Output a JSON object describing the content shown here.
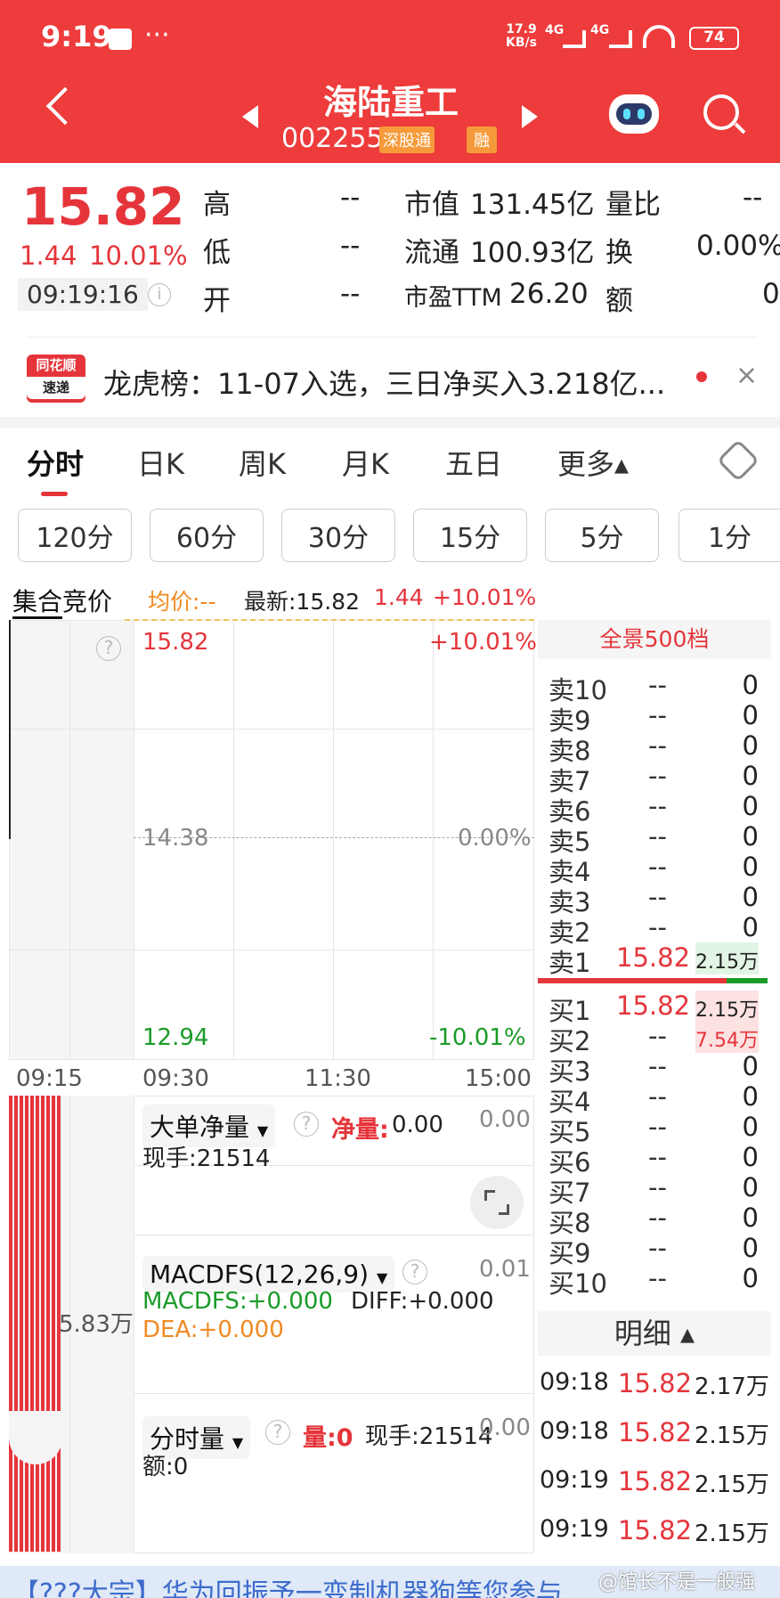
{
  "status_bar": {
    "time": "9:19",
    "dots": "···",
    "net_speed_top": "17.9",
    "net_speed_unit": "KB/s",
    "sig1": "4G",
    "sig2": "4G",
    "battery": "74"
  },
  "header": {
    "title": "海陆重工",
    "code": "002255",
    "badge_connect": "深股通",
    "badge_margin": "融"
  },
  "quote": {
    "price": "15.82",
    "change": "1.44",
    "change_pct": "10.01%",
    "time": "09:19:16",
    "fields": [
      {
        "label": "高",
        "value": "--"
      },
      {
        "label": "低",
        "value": "--"
      },
      {
        "label": "开",
        "value": "--"
      }
    ],
    "mid": [
      {
        "label": "市值",
        "value": "131.45亿"
      },
      {
        "label": "流通",
        "value": "100.93亿"
      },
      {
        "label": "市盈TTM",
        "value": "26.20"
      }
    ],
    "right": [
      {
        "label": "量比",
        "value": "--"
      },
      {
        "label": "换",
        "value": "0.00%"
      },
      {
        "label": "额",
        "value": "0"
      }
    ]
  },
  "news": {
    "logo_top": "同花顺",
    "logo_bottom": "速递",
    "text": "龙虎榜：11-07入选，三日净买入3.218亿..."
  },
  "tabs": [
    "分时",
    "日K",
    "周K",
    "月K",
    "五日",
    "更多▴"
  ],
  "periods": [
    "120分",
    "60分",
    "30分",
    "15分",
    "5分",
    "1分"
  ],
  "info_bar": {
    "auction": "集合竞价",
    "avg_label": "均价:--",
    "latest": "最新:15.82",
    "chg": "1.44",
    "pct": "+10.01%"
  },
  "chart": {
    "top_price": "15.82",
    "top_pct": "+10.01%",
    "mid_price": "14.38",
    "mid_pct": "0.00%",
    "bot_price": "12.94",
    "bot_pct": "-10.01%",
    "times": [
      "09:15",
      "09:30",
      "11:30",
      "15:00"
    ],
    "vol_label": "5.83万"
  },
  "orderbook": {
    "title": "全景500档",
    "sells": [
      {
        "label": "卖10",
        "price": "--",
        "vol": "0"
      },
      {
        "label": "卖9",
        "price": "--",
        "vol": "0"
      },
      {
        "label": "卖8",
        "price": "--",
        "vol": "0"
      },
      {
        "label": "卖7",
        "price": "--",
        "vol": "0"
      },
      {
        "label": "卖6",
        "price": "--",
        "vol": "0"
      },
      {
        "label": "卖5",
        "price": "--",
        "vol": "0"
      },
      {
        "label": "卖4",
        "price": "--",
        "vol": "0"
      },
      {
        "label": "卖3",
        "price": "--",
        "vol": "0"
      },
      {
        "label": "卖2",
        "price": "--",
        "vol": "0"
      },
      {
        "label": "卖1",
        "price": "15.82",
        "vol": "2.15万"
      }
    ],
    "buys": [
      {
        "label": "买1",
        "price": "15.82",
        "vol": "2.15万"
      },
      {
        "label": "买2",
        "price": "--",
        "vol": "7.54万"
      },
      {
        "label": "买3",
        "price": "--",
        "vol": "0"
      },
      {
        "label": "买4",
        "price": "--",
        "vol": "0"
      },
      {
        "label": "买5",
        "price": "--",
        "vol": "0"
      },
      {
        "label": "买6",
        "price": "--",
        "vol": "0"
      },
      {
        "label": "买7",
        "price": "--",
        "vol": "0"
      },
      {
        "label": "买8",
        "price": "--",
        "vol": "0"
      },
      {
        "label": "买9",
        "price": "--",
        "vol": "0"
      },
      {
        "label": "买10",
        "price": "--",
        "vol": "0"
      }
    ]
  },
  "detail": {
    "title": "明细 ▴",
    "rows": [
      {
        "time": "09:18",
        "price": "15.82",
        "vol": "2.17万"
      },
      {
        "time": "09:18",
        "price": "15.82",
        "vol": "2.15万"
      },
      {
        "time": "09:19",
        "price": "15.82",
        "vol": "2.15万"
      },
      {
        "time": "09:19",
        "price": "15.82",
        "vol": "2.15万"
      }
    ]
  },
  "indicators": {
    "big": {
      "name": "大单净量",
      "net_label": "净量:",
      "net_val": "0.00",
      "right_val": "0.00",
      "hand": "现手:21514"
    },
    "macd": {
      "name": "MACDFS(12,26,9)",
      "right_val": "0.01",
      "macdfs": "MACDFS:+0.000",
      "diff": "DIFF:+0.000",
      "dea": "DEA:+0.000"
    },
    "vol": {
      "name": "分时量",
      "vol_label": "量:0",
      "hand": "现手:21514",
      "right_val": "0.00",
      "amount": "额:0"
    }
  },
  "watermark": "@馆长不是一般强",
  "bottom_banner": "【???大宗】华为回振予一变制机器狗等您参与"
}
